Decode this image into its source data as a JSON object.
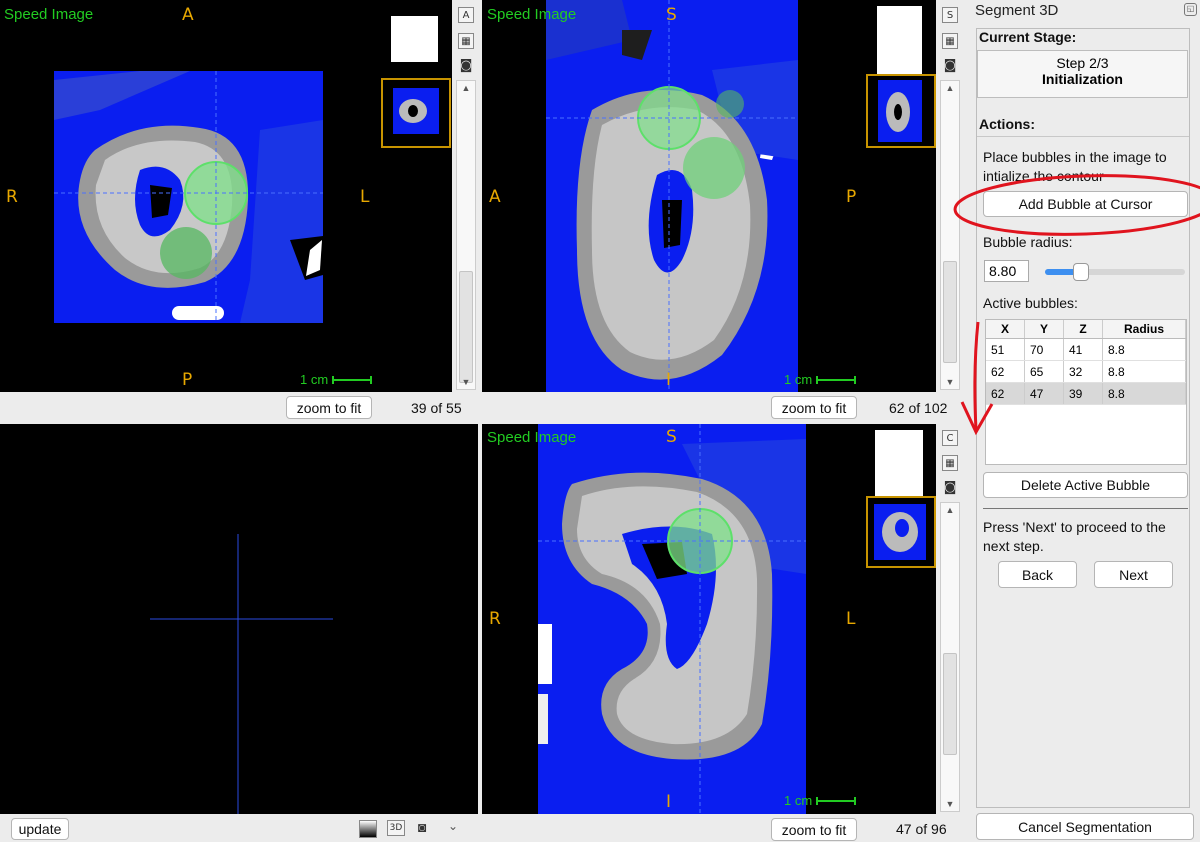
{
  "views": {
    "top_left": {
      "name": "Speed Image",
      "labels": {
        "top": "A",
        "left": "R",
        "right": "L",
        "bottom": "P"
      },
      "scale": "1 cm",
      "zoom_label": "zoom to fit",
      "slice": "39 of 55",
      "toolbar": [
        "A"
      ]
    },
    "top_right": {
      "name": "Speed Image",
      "labels": {
        "top": "S",
        "left": "A",
        "right": "P",
        "bottom": "I"
      },
      "scale": "1 cm",
      "zoom_label": "zoom to fit",
      "slice": "62 of 102",
      "toolbar": [
        "S"
      ]
    },
    "bottom_left": {
      "update_label": "update",
      "mode_label": "3D"
    },
    "bottom_right": {
      "name": "Speed Image",
      "labels": {
        "top": "S",
        "left": "R",
        "right": "L",
        "bottom": "I"
      },
      "scale": "1 cm",
      "zoom_label": "zoom to fit",
      "slice": "47 of 96",
      "toolbar": [
        "C"
      ]
    }
  },
  "panel": {
    "title": "Segment 3D",
    "current_stage_heading": "Current Stage:",
    "stage_step": "Step 2/3",
    "stage_name": "Initialization",
    "actions_heading": "Actions:",
    "instruction": "Place bubbles in the image to intialize the contour",
    "add_bubble_label": "Add Bubble at Cursor",
    "radius_label": "Bubble radius:",
    "radius_value": "8.80",
    "radius_fraction": 0.25,
    "active_label": "Active bubbles:",
    "table_headers": [
      "X",
      "Y",
      "Z",
      "Radius"
    ],
    "bubbles": [
      {
        "x": "51",
        "y": "70",
        "z": "41",
        "r": "8.8"
      },
      {
        "x": "62",
        "y": "65",
        "z": "32",
        "r": "8.8"
      },
      {
        "x": "62",
        "y": "47",
        "z": "39",
        "r": "8.8"
      }
    ],
    "delete_label": "Delete Active Bubble",
    "next_instruction": "Press 'Next' to proceed to the next step.",
    "back_label": "Back",
    "next_label": "Next",
    "cancel_label": "Cancel Segmentation"
  },
  "colors": {
    "speed_blue": "#0a1ef0",
    "bubble_green": "#7fe08a",
    "annotation_red": "#e0141e",
    "orientation": "#e8a800",
    "label_green": "#22cc22"
  }
}
